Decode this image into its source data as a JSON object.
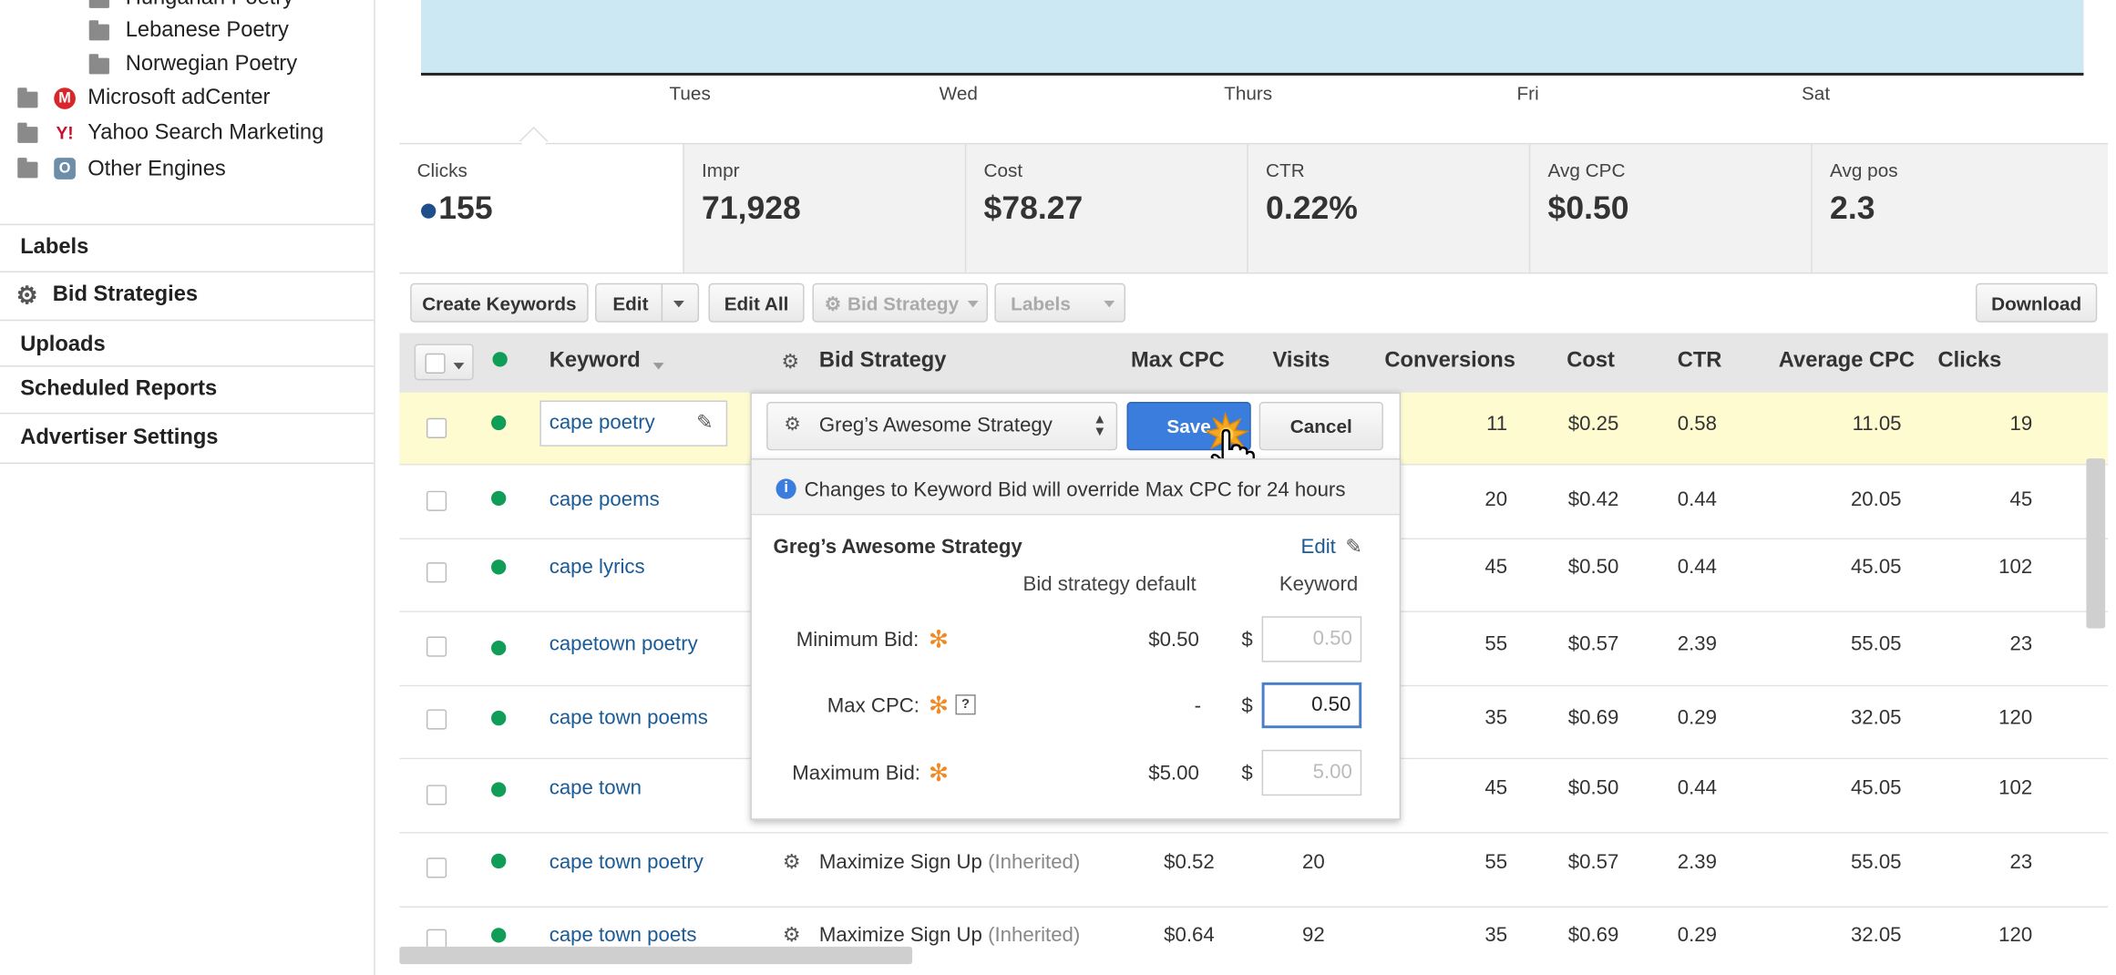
{
  "sidebar": {
    "tree": [
      {
        "label": "Hungarian Poetry"
      },
      {
        "label": "Lebanese Poetry"
      },
      {
        "label": "Norwegian Poetry"
      },
      {
        "label": "Microsoft adCenter",
        "icon": "microsoft-adcenter-icon"
      },
      {
        "label": "Yahoo Search Marketing",
        "icon": "yahoo-icon"
      },
      {
        "label": "Other Engines",
        "icon": "other-engines-icon"
      }
    ],
    "sections": [
      "Labels",
      "Bid Strategies",
      "Uploads",
      "Scheduled Reports",
      "Advertiser Settings"
    ]
  },
  "chart": {
    "days": [
      "Tues",
      "Wed",
      "Thurs",
      "Fri",
      "Sat"
    ],
    "fill_color": "#cce8f3"
  },
  "stats": [
    {
      "label": "Clicks",
      "value": "155"
    },
    {
      "label": "Impr",
      "value": "71,928"
    },
    {
      "label": "Cost",
      "value": "$78.27"
    },
    {
      "label": "CTR",
      "value": "0.22%"
    },
    {
      "label": "Avg CPC",
      "value": "$0.50"
    },
    {
      "label": "Avg pos",
      "value": "2.3"
    }
  ],
  "toolbar": {
    "create_keywords": "Create Keywords",
    "edit": "Edit",
    "edit_all": "Edit All",
    "bid_strategy": "Bid Strategy",
    "labels": "Labels",
    "download": "Download"
  },
  "columns": {
    "keyword": "Keyword",
    "bid_strategy": "Bid Strategy",
    "max_cpc": "Max CPC",
    "visits": "Visits",
    "conversions": "Conversions",
    "cost": "Cost",
    "ctr": "CTR",
    "average_cpc": "Average CPC",
    "clicks": "Clicks"
  },
  "rows": [
    {
      "keyword": "cape poetry",
      "conversions": "11",
      "cost": "$0.25",
      "ctr": "0.58",
      "average_cpc": "11.05",
      "clicks": "19"
    },
    {
      "keyword": "cape poems",
      "conversions": "20",
      "cost": "$0.42",
      "ctr": "0.44",
      "average_cpc": "20.05",
      "clicks": "45"
    },
    {
      "keyword": "cape lyrics",
      "conversions": "45",
      "cost": "$0.50",
      "ctr": "0.44",
      "average_cpc": "45.05",
      "clicks": "102"
    },
    {
      "keyword": "capetown poetry",
      "conversions": "55",
      "cost": "$0.57",
      "ctr": "2.39",
      "average_cpc": "55.05",
      "clicks": "23"
    },
    {
      "keyword": "cape town poems",
      "conversions": "35",
      "cost": "$0.69",
      "ctr": "0.29",
      "average_cpc": "32.05",
      "clicks": "120"
    },
    {
      "keyword": "cape town",
      "conversions": "45",
      "cost": "$0.50",
      "ctr": "0.44",
      "average_cpc": "45.05",
      "clicks": "102"
    },
    {
      "keyword": "cape town poetry",
      "bid_strategy": "Maximize Sign Up",
      "inherited": "(Inherited)",
      "max_cpc": "$0.52",
      "visits": "20",
      "conversions": "55",
      "cost": "$0.57",
      "ctr": "2.39",
      "average_cpc": "55.05",
      "clicks": "23"
    },
    {
      "keyword": "cape town poets",
      "bid_strategy": "Maximize Sign Up",
      "inherited": "(Inherited)",
      "max_cpc": "$0.64",
      "visits": "92",
      "conversions": "35",
      "cost": "$0.69",
      "ctr": "0.29",
      "average_cpc": "32.05",
      "clicks": "120"
    }
  ],
  "edit_row": {
    "keyword_value": "cape poetry",
    "strategy_selected": "Greg’s Awesome Strategy",
    "save_label": "Save",
    "cancel_label": "Cancel"
  },
  "popup": {
    "notice": "Changes to Keyword Bid will override Max CPC for 24 hours",
    "strategy_name": "Greg’s Awesome Strategy",
    "edit_label": "Edit",
    "col_default": "Bid strategy default",
    "col_keyword": "Keyword",
    "fields": [
      {
        "label": "Minimum Bid:",
        "default": "$0.50",
        "currency": "$",
        "value": "0.50"
      },
      {
        "label": "Max CPC:",
        "default": "-",
        "currency": "$",
        "value": "0.50",
        "help": "?"
      },
      {
        "label": "Maximum Bid:",
        "default": "$5.00",
        "currency": "$",
        "value": "5.00"
      }
    ]
  },
  "colors": {
    "accent": "#3b7ddd",
    "link": "#1a5a96",
    "status_active": "#0f9d58",
    "required": "#f08a24",
    "selected_row": "#fdfbcf"
  }
}
